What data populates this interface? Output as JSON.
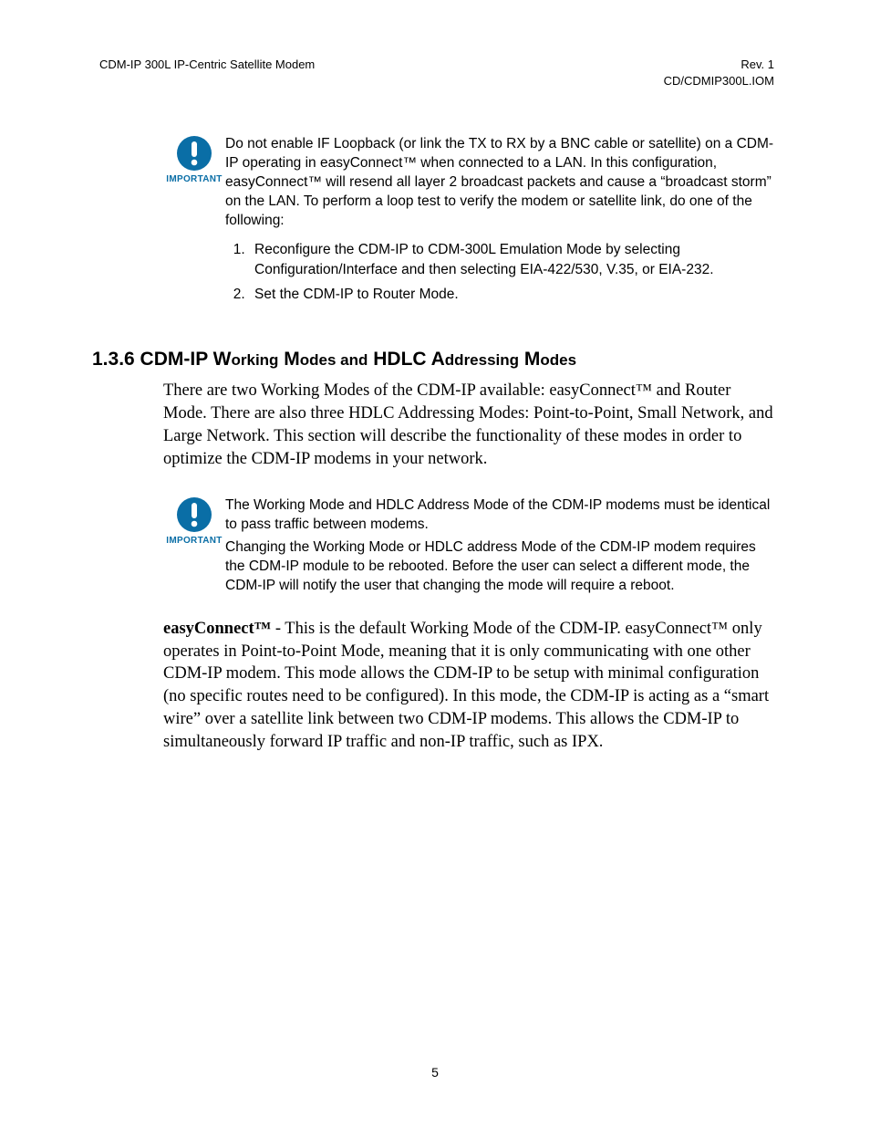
{
  "header": {
    "left": "CDM-IP 300L IP-Centric Satellite Modem",
    "right1": "Rev. 1",
    "right2": "CD/CDMIP300L.IOM"
  },
  "importantLabel": "IMPORTANT",
  "note1": {
    "text": "Do not enable IF Loopback (or link the TX to RX by a BNC cable or satellite) on a CDM-IP operating in easyConnect™ when connected to a LAN. In this configuration, easyConnect™ will resend all layer 2 broadcast packets and cause a “broadcast storm” on the LAN. To perform a loop test to verify the modem or satellite link, do one of the following:",
    "li1": "Reconfigure the CDM-IP to CDM-300L Emulation Mode by selecting Configuration/Interface and then selecting EIA-422/530, V.35, or EIA-232.",
    "li2": "Set the CDM-IP to Router Mode."
  },
  "section": {
    "num": "1.3.6",
    "rest_a": " CDM-IP W",
    "rest_b": "orking",
    "rest_c": " M",
    "rest_d": "odes and",
    "rest_e": " HDLC A",
    "rest_f": "ddressing",
    "rest_g": " M",
    "rest_h": "odes"
  },
  "intro": "There are two Working Modes of the CDM-IP available: easyConnect™ and Router Mode. There are also three HDLC Addressing Modes: Point-to-Point, Small Network, and Large Network. This section will describe the functionality of these modes in order to optimize the CDM-IP modems in your network.",
  "note2": {
    "p1": "The Working Mode and HDLC Address Mode of the CDM-IP modems must be identical to pass traffic between modems.",
    "p2": "Changing the Working Mode or HDLC address Mode of the CDM-IP modem requires the CDM-IP module to be rebooted. Before the user can select a different mode, the CDM-IP will notify the user that changing the mode will require a reboot."
  },
  "easy": {
    "bold": "easyConnect™",
    "rest": " - This is the default Working Mode of the CDM-IP. easyConnect™ only operates in Point-to-Point Mode, meaning that it is only communicating with one other CDM-IP modem. This mode allows the CDM-IP to be setup with minimal configuration (no specific routes need to be configured). In this mode, the CDM-IP is acting as a “smart wire” over a satellite link between two CDM-IP modems. This allows the CDM-IP to simultaneously forward IP traffic and non-IP traffic, such as IPX."
  },
  "pageNumber": "5"
}
